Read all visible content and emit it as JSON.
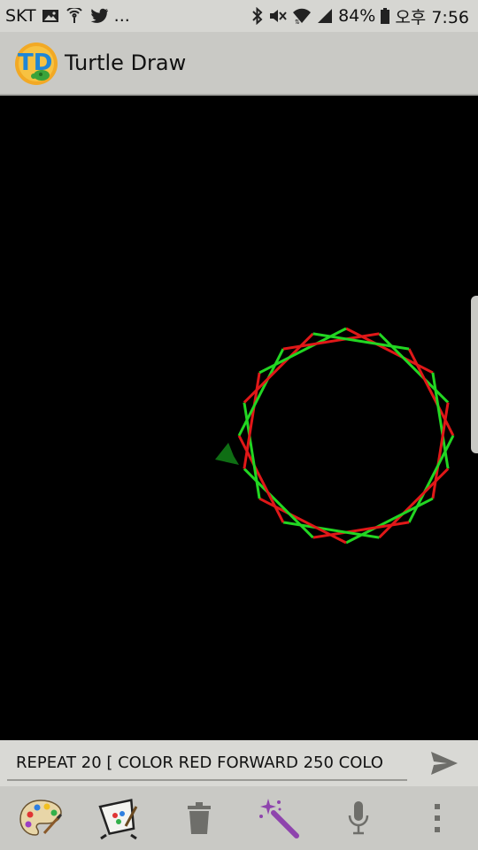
{
  "status_bar": {
    "carrier": "SKT",
    "more": "...",
    "battery": "84%",
    "time": "오후 7:56",
    "icons": [
      "image-icon",
      "wifi-calling-icon",
      "twitter-icon",
      "bluetooth-icon",
      "mute-icon",
      "wifi-icon",
      "signal-icon",
      "battery-icon"
    ]
  },
  "app_bar": {
    "title": "Turtle Draw",
    "logo": "turtle-draw-logo"
  },
  "drawing": {
    "star_count": 20,
    "colors": {
      "red": "#e01818",
      "green": "#22d622",
      "turtle": "#0f6e14",
      "background": "#000000"
    }
  },
  "command_bar": {
    "input_value": "REPEAT 20 [ COLOR RED FORWARD 250 COLO",
    "send_icon": "send-icon"
  },
  "toolbar": {
    "items": [
      "palette-icon",
      "canvas-settings-icon",
      "trash-icon",
      "magic-wand-icon",
      "microphone-icon",
      "overflow-menu-icon"
    ]
  },
  "colors": {
    "status_bar_bg": "#d6d6d2",
    "app_bar_bg": "#c9c9c5",
    "accent_purple": "#8e44ad"
  }
}
